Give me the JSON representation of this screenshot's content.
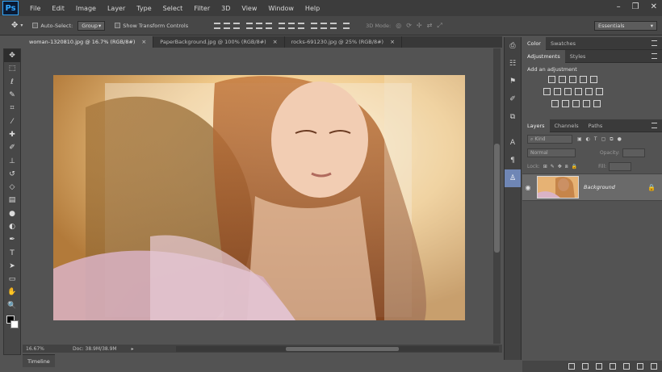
{
  "app": {
    "logo": "Ps"
  },
  "menu": [
    "File",
    "Edit",
    "Image",
    "Layer",
    "Type",
    "Select",
    "Filter",
    "3D",
    "View",
    "Window",
    "Help"
  ],
  "window_controls": {
    "minimize": "–",
    "restore": "❐",
    "close": "✕"
  },
  "options": {
    "auto_select_label": "Auto-Select:",
    "auto_select_value": "Group",
    "show_transform_label": "Show Transform Controls",
    "mode_3d_label": "3D Mode:",
    "workspace": "Essentials"
  },
  "tabs": [
    {
      "label": "woman-1320810.jpg @ 16.7% (RGB/8#)",
      "active": true
    },
    {
      "label": "PaperBackground.jpg @ 100% (RGB/8#)",
      "active": false
    },
    {
      "label": "rocks-691230.jpg @ 25% (RGB/8#)",
      "active": false
    }
  ],
  "tools": [
    "move-tool-icon",
    "marquee-icon",
    "lasso-icon",
    "quick-select-icon",
    "crop-icon",
    "eyedropper-icon",
    "healing-icon",
    "brush-icon",
    "stamp-icon",
    "history-brush-icon",
    "eraser-icon",
    "gradient-icon",
    "blur-icon",
    "dodge-icon",
    "pen-icon",
    "type-icon",
    "path-select-icon",
    "shape-icon",
    "hand-icon",
    "zoom-icon"
  ],
  "tool_glyphs": [
    "✥",
    "⬚",
    "ℓ",
    "✎",
    "⌗",
    "⁄",
    "✚",
    "✐",
    "⊥",
    "↺",
    "◇",
    "▤",
    "●",
    "◐",
    "✒",
    "T",
    "➤",
    "▭",
    "✋",
    "🔍"
  ],
  "status": {
    "zoom": "16.67%",
    "doc": "Doc: 38.9M/38.9M"
  },
  "timeline_label": "Timeline",
  "panels": {
    "color_tabs": [
      "Color",
      "Swatches"
    ],
    "adjust_tabs": [
      "Adjustments",
      "Styles"
    ],
    "add_adjustment": "Add an adjustment",
    "layers_tabs": [
      "Layers",
      "Channels",
      "Paths"
    ],
    "kind_placeholder": "Kind",
    "blend_mode": "Normal",
    "opacity_label": "Opacity:",
    "lock_label": "Lock:",
    "fill_label": "Fill:",
    "layer_name": "Background"
  },
  "colors": {
    "accent": "#31a8ff",
    "chrome": "#3c3c3c",
    "panel": "#535353"
  }
}
